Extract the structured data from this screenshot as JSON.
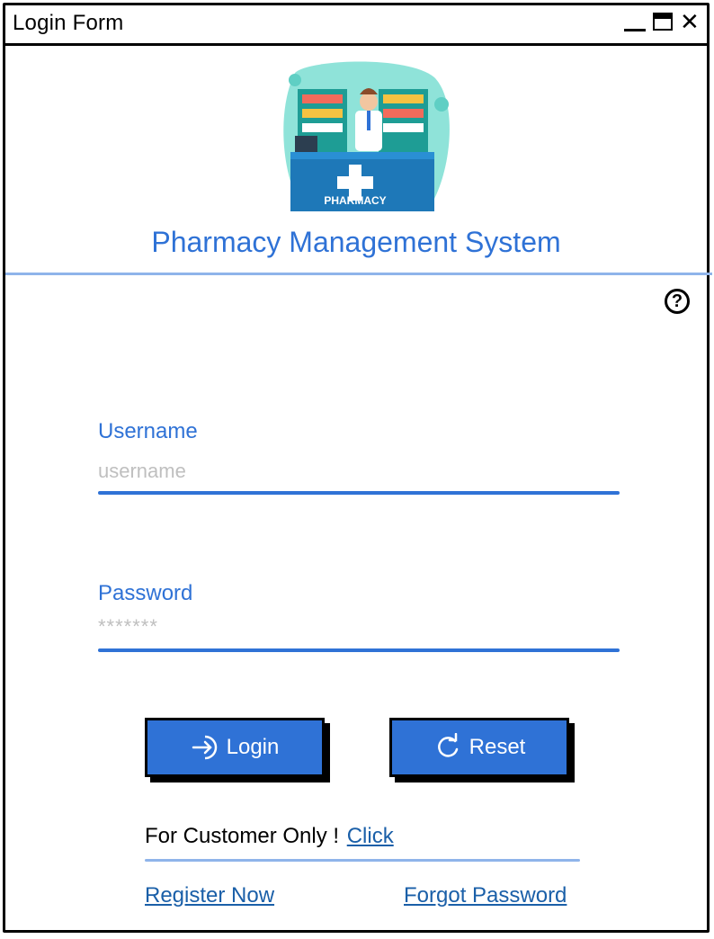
{
  "window": {
    "title": "Login Form"
  },
  "header": {
    "app_title": "Pharmacy Management System",
    "logo_sign": "PHARMACY"
  },
  "form": {
    "username": {
      "label": "Username",
      "placeholder": "username"
    },
    "password": {
      "label": "Password",
      "placeholder": "*******"
    }
  },
  "buttons": {
    "login": "Login",
    "reset": "Reset"
  },
  "customer": {
    "text": "For Customer Only !",
    "link": "Click"
  },
  "links": {
    "register": "Register Now",
    "forgot": "Forgot Password"
  },
  "colors": {
    "accent": "#2f72d6",
    "link": "#1a5fa8",
    "divider": "#8fb4ea"
  },
  "icons": [
    "minimize-icon",
    "maximize-icon",
    "close-icon",
    "help-icon",
    "login-icon",
    "reset-icon",
    "pharmacy-logo"
  ]
}
